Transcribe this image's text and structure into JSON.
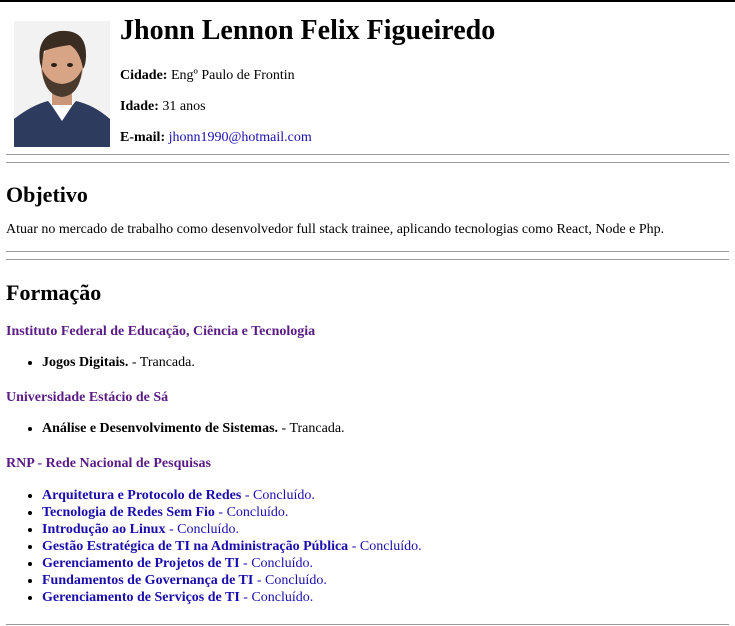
{
  "profile": {
    "name": "Jhonn Lennon Felix Figueiredo",
    "city_label": "Cidade:",
    "city_value": "Engº Paulo de Frontin",
    "age_label": "Idade:",
    "age_value": "31 anos",
    "email_label": "E-mail:",
    "email_value": "jhonn1990@hotmail.com"
  },
  "objective": {
    "title": "Objetivo",
    "text": "Atuar no mercado de trabalho como desenvolvedor full stack trainee, aplicando tecnologias como React, Node e Php."
  },
  "education": {
    "title": "Formação",
    "institutions": [
      {
        "name": "Instituto Federal de Educação, Ciência e Tecnologia",
        "courses": [
          {
            "name": "Jogos Digitais.",
            "status": " - Trancada."
          }
        ]
      },
      {
        "name": "Universidade Estácio de Sá",
        "courses": [
          {
            "name": "Análise e Desenvolvimento de Sistemas.",
            "status": " - Trancada."
          }
        ]
      },
      {
        "name": "RNP - Rede Nacional de Pesquisas",
        "courses": [
          {
            "name": "Arquitetura e Protocolo de Redes",
            "status": " - Concluído."
          },
          {
            "name": "Tecnologia de Redes Sem Fio",
            "status": " - Concluído."
          },
          {
            "name": "Introdução ao Linux",
            "status": " - Concluído."
          },
          {
            "name": "Gestão Estratégica de TI na Administração Pública",
            "status": " - Concluído."
          },
          {
            "name": "Gerenciamento de Projetos de TI",
            "status": " - Concluído."
          },
          {
            "name": "Fundamentos de Governança de TI",
            "status": " - Concluído."
          },
          {
            "name": "Gerenciamento de Serviços de TI",
            "status": " - Concluído."
          }
        ]
      }
    ]
  },
  "colors": {
    "link": "#1a0dab",
    "visited_link": "#5a1c84",
    "rule": "#999999"
  }
}
